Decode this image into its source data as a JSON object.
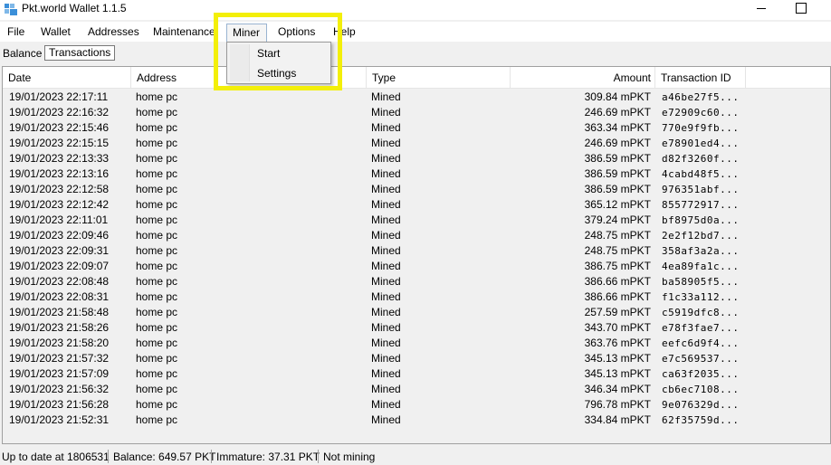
{
  "window": {
    "title": "Pkt.world Wallet 1.1.5"
  },
  "menu": {
    "file": "File",
    "wallet": "Wallet",
    "addresses": "Addresses",
    "maintenance": "Maintenance",
    "miner": "Miner",
    "options": "Options",
    "help": "Help"
  },
  "miner_menu": {
    "start": "Start",
    "settings": "Settings"
  },
  "tabs": {
    "balance": "Balance",
    "transactions": "Transactions"
  },
  "table": {
    "headers": {
      "date": "Date",
      "address": "Address",
      "type": "Type",
      "amount": "Amount",
      "txid": "Transaction ID"
    },
    "rows": [
      {
        "date": "19/01/2023 22:17:11",
        "address": "home pc",
        "type": "Mined",
        "amount": "309.84 mPKT",
        "txid": "a46be27f5..."
      },
      {
        "date": "19/01/2023 22:16:32",
        "address": "home pc",
        "type": "Mined",
        "amount": "246.69 mPKT",
        "txid": "e72909c60..."
      },
      {
        "date": "19/01/2023 22:15:46",
        "address": "home pc",
        "type": "Mined",
        "amount": "363.34 mPKT",
        "txid": "770e9f9fb..."
      },
      {
        "date": "19/01/2023 22:15:15",
        "address": "home pc",
        "type": "Mined",
        "amount": "246.69 mPKT",
        "txid": "e78901ed4..."
      },
      {
        "date": "19/01/2023 22:13:33",
        "address": "home pc",
        "type": "Mined",
        "amount": "386.59 mPKT",
        "txid": "d82f3260f..."
      },
      {
        "date": "19/01/2023 22:13:16",
        "address": "home pc",
        "type": "Mined",
        "amount": "386.59 mPKT",
        "txid": "4cabd48f5..."
      },
      {
        "date": "19/01/2023 22:12:58",
        "address": "home pc",
        "type": "Mined",
        "amount": "386.59 mPKT",
        "txid": "976351abf..."
      },
      {
        "date": "19/01/2023 22:12:42",
        "address": "home pc",
        "type": "Mined",
        "amount": "365.12 mPKT",
        "txid": "855772917..."
      },
      {
        "date": "19/01/2023 22:11:01",
        "address": "home pc",
        "type": "Mined",
        "amount": "379.24 mPKT",
        "txid": "bf8975d0a..."
      },
      {
        "date": "19/01/2023 22:09:46",
        "address": "home pc",
        "type": "Mined",
        "amount": "248.75 mPKT",
        "txid": "2e2f12bd7..."
      },
      {
        "date": "19/01/2023 22:09:31",
        "address": "home pc",
        "type": "Mined",
        "amount": "248.75 mPKT",
        "txid": "358af3a2a..."
      },
      {
        "date": "19/01/2023 22:09:07",
        "address": "home pc",
        "type": "Mined",
        "amount": "386.75 mPKT",
        "txid": "4ea89fa1c..."
      },
      {
        "date": "19/01/2023 22:08:48",
        "address": "home pc",
        "type": "Mined",
        "amount": "386.66 mPKT",
        "txid": "ba58905f5..."
      },
      {
        "date": "19/01/2023 22:08:31",
        "address": "home pc",
        "type": "Mined",
        "amount": "386.66 mPKT",
        "txid": "f1c33a112..."
      },
      {
        "date": "19/01/2023 21:58:48",
        "address": "home pc",
        "type": "Mined",
        "amount": "257.59 mPKT",
        "txid": "c5919dfc8..."
      },
      {
        "date": "19/01/2023 21:58:26",
        "address": "home pc",
        "type": "Mined",
        "amount": "343.70 mPKT",
        "txid": "e78f3fae7..."
      },
      {
        "date": "19/01/2023 21:58:20",
        "address": "home pc",
        "type": "Mined",
        "amount": "363.76 mPKT",
        "txid": "eefc6d9f4..."
      },
      {
        "date": "19/01/2023 21:57:32",
        "address": "home pc",
        "type": "Mined",
        "amount": "345.13 mPKT",
        "txid": "e7c569537..."
      },
      {
        "date": "19/01/2023 21:57:09",
        "address": "home pc",
        "type": "Mined",
        "amount": "345.13 mPKT",
        "txid": "ca63f2035..."
      },
      {
        "date": "19/01/2023 21:56:32",
        "address": "home pc",
        "type": "Mined",
        "amount": "346.34 mPKT",
        "txid": "cb6ec7108..."
      },
      {
        "date": "19/01/2023 21:56:28",
        "address": "home pc",
        "type": "Mined",
        "amount": "796.78 mPKT",
        "txid": "9e076329d..."
      },
      {
        "date": "19/01/2023 21:52:31",
        "address": "home pc",
        "type": "Mined",
        "amount": "334.84 mPKT",
        "txid": "62f35759d..."
      }
    ]
  },
  "status": {
    "sync": "Up to date at 1806531",
    "balance": "Balance: 649.57 PKT",
    "immature": "Immature: 37.31 PKT",
    "mining": "Not mining"
  },
  "colors": {
    "highlight": "#f3ef09",
    "app_icon": "#3b8fd9"
  }
}
